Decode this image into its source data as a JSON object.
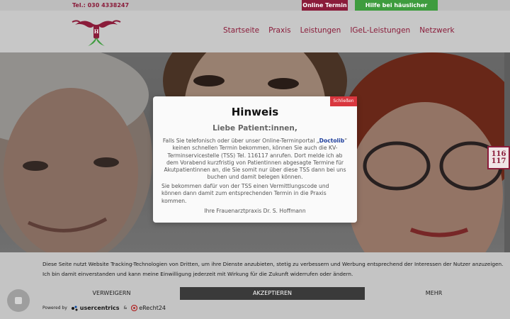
{
  "topbar": {
    "phone": "Tel.: 030 4338247",
    "online_termin": "Online Termin",
    "help_violence": "Hilfe bei häuslicher Gewalt"
  },
  "nav": {
    "items": [
      "Startseite",
      "Praxis",
      "Leistungen",
      "IGeL-Leistungen",
      "Netzwerk"
    ]
  },
  "badge": {
    "line1": "116",
    "line2": "117"
  },
  "modal": {
    "close": "Schließen",
    "title": "Hinweis",
    "subtitle": "Liebe Patient:innen,",
    "p1_before": "Falls Sie telefonisch oder über unser Online-Terminportal „",
    "p1_link": "Doctolib",
    "p1_after": "“ keinen schnellen Termin bekommen, können Sie auch die KV-Terminservicestelle (TSS) Tel. 116117 anrufen. Dort melde ich ab dem Vorabend kurzfristig von Patientinnen abgesagte Termine für Akutpatientinnen an, die Sie somit nur über diese TSS dann bei uns buchen und damit belegen können.",
    "p2": "Sie bekommen dafür von der TSS einen Vermittlungscode und können dann damit zum entsprechenden Termin in die Praxis kommen.",
    "sign": "Ihre Frauenarztpraxis Dr. S. Hoffmann"
  },
  "cookie": {
    "text": "Diese Seite nutzt Website Tracking-Technologien von Dritten, um ihre Dienste anzubieten, stetig zu verbessern und Werbung entsprechend der Interessen der Nutzer anzuzeigen. Ich bin damit einverstanden und kann meine Einwilligung jederzeit mit Wirkung für die Zukunft widerrufen oder ändern.",
    "reject": "VERWEIGERN",
    "accept": "AKZEPTIEREN",
    "more": "MEHR",
    "powered_by": "Powered by",
    "usercentrics": "usercentrics",
    "amp": "&",
    "erecht": "eRecht24"
  },
  "colors": {
    "brand": "#8a1c3a",
    "green": "#3e9c3e",
    "close": "#d9363e",
    "accept": "#3a3a3a"
  }
}
